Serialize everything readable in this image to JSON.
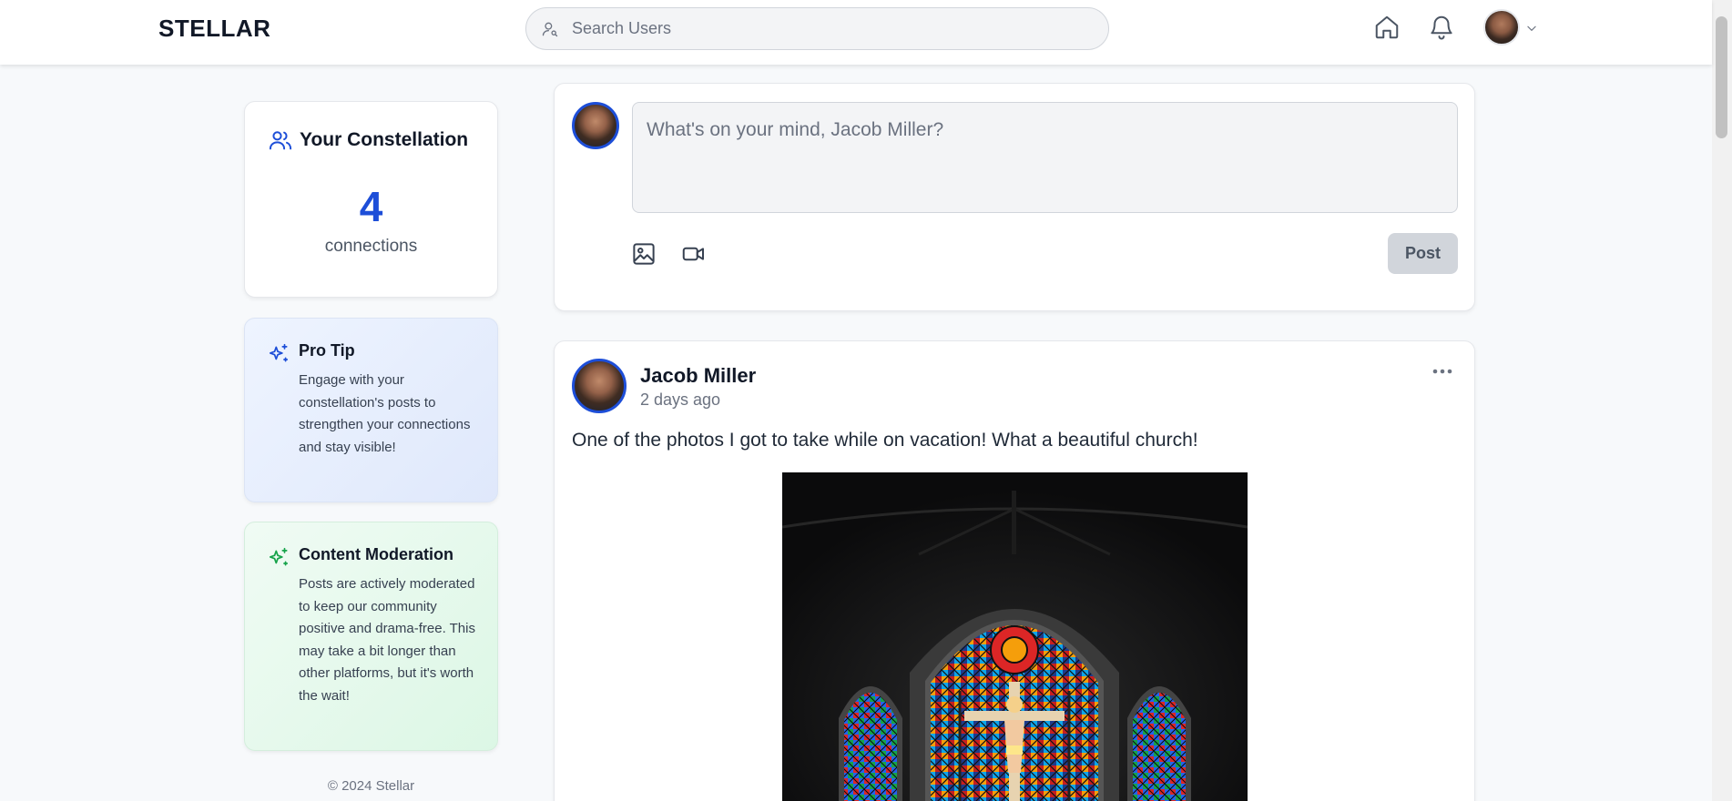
{
  "header": {
    "logo": "STELLAR",
    "search_placeholder": "Search Users",
    "icons": [
      "home-icon",
      "bell-icon",
      "avatar",
      "chevron-down-icon"
    ]
  },
  "sidebar": {
    "constellation": {
      "title": "Your Constellation",
      "count": "4",
      "label": "connections",
      "icon": "users-icon"
    },
    "pro_tip": {
      "title": "Pro Tip",
      "text": "Engage with your constellation's posts to strengthen your connections and stay visible!",
      "icon": "sparkles-icon",
      "accent": "#1d4ed8"
    },
    "moderation": {
      "title": "Content Moderation",
      "text": "Posts are actively moderated to keep our community positive and drama-free. This may take a bit longer than other platforms, but it's worth the wait!",
      "icon": "sparkles-icon",
      "accent": "#16a34a"
    },
    "footer": "© 2024 Stellar"
  },
  "composer": {
    "placeholder": "What's on your mind, Jacob Miller?",
    "post_label": "Post",
    "icons": [
      "image-icon",
      "video-icon"
    ]
  },
  "feed": {
    "posts": [
      {
        "author": "Jacob Miller",
        "time": "2 days ago",
        "text": "One of the photos I got to take while on vacation! What a beautiful church!",
        "image": "stained-glass-church-window"
      }
    ]
  },
  "colors": {
    "accent": "#1d4ed8",
    "background": "#f7f9fb"
  }
}
